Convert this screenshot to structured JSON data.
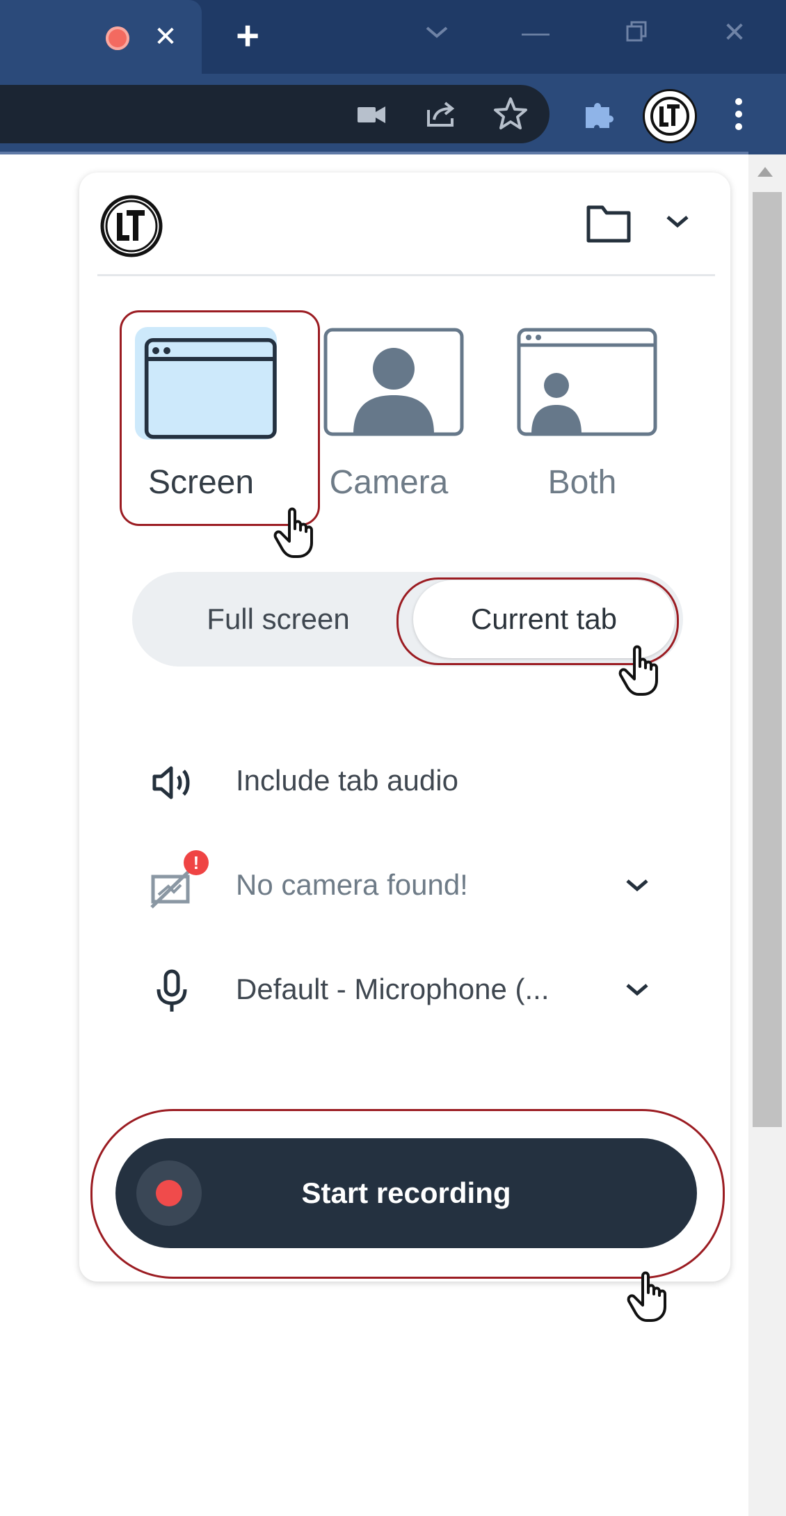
{
  "browser": {
    "active_tab": {
      "icon": "recording-dot-icon",
      "close_glyph": "✕"
    },
    "new_tab_glyph": "+",
    "window_controls": {
      "dropdown": "chevron-down-icon",
      "minimize_glyph": "—",
      "restore": "restore-icon",
      "close_glyph": "✕"
    },
    "toolbar_icons": [
      "camera-icon",
      "share-icon",
      "star-icon",
      "puzzle-icon",
      "extension-logo-icon",
      "kebab-menu-icon"
    ]
  },
  "popup": {
    "header": {
      "logo": "LT",
      "folder": "folder-icon",
      "menu": "chevron-down-icon"
    },
    "modes": [
      {
        "id": "screen",
        "label": "Screen",
        "selected": true
      },
      {
        "id": "camera",
        "label": "Camera",
        "selected": false
      },
      {
        "id": "both",
        "label": "Both",
        "selected": false
      }
    ],
    "capture_options": [
      {
        "label": "Full screen",
        "selected": false
      },
      {
        "label": "Current tab",
        "selected": true
      }
    ],
    "settings": [
      {
        "icon": "speaker-icon",
        "label": "Include tab audio",
        "has_dropdown": false
      },
      {
        "icon": "camera-off-icon",
        "label": "No camera found!",
        "has_dropdown": true,
        "alert_glyph": "!"
      },
      {
        "icon": "microphone-icon",
        "label": "Default - Microphone (...",
        "has_dropdown": true
      }
    ],
    "record_button": {
      "label": "Start recording"
    }
  },
  "colors": {
    "tabstrip": "#1f3a66",
    "toolbar": "#2b4a7a",
    "highlight": "#9b1c22",
    "selected_mode_bg": "#cde9fb",
    "record_button": "#243140",
    "record_dot": "#f04b4b"
  }
}
